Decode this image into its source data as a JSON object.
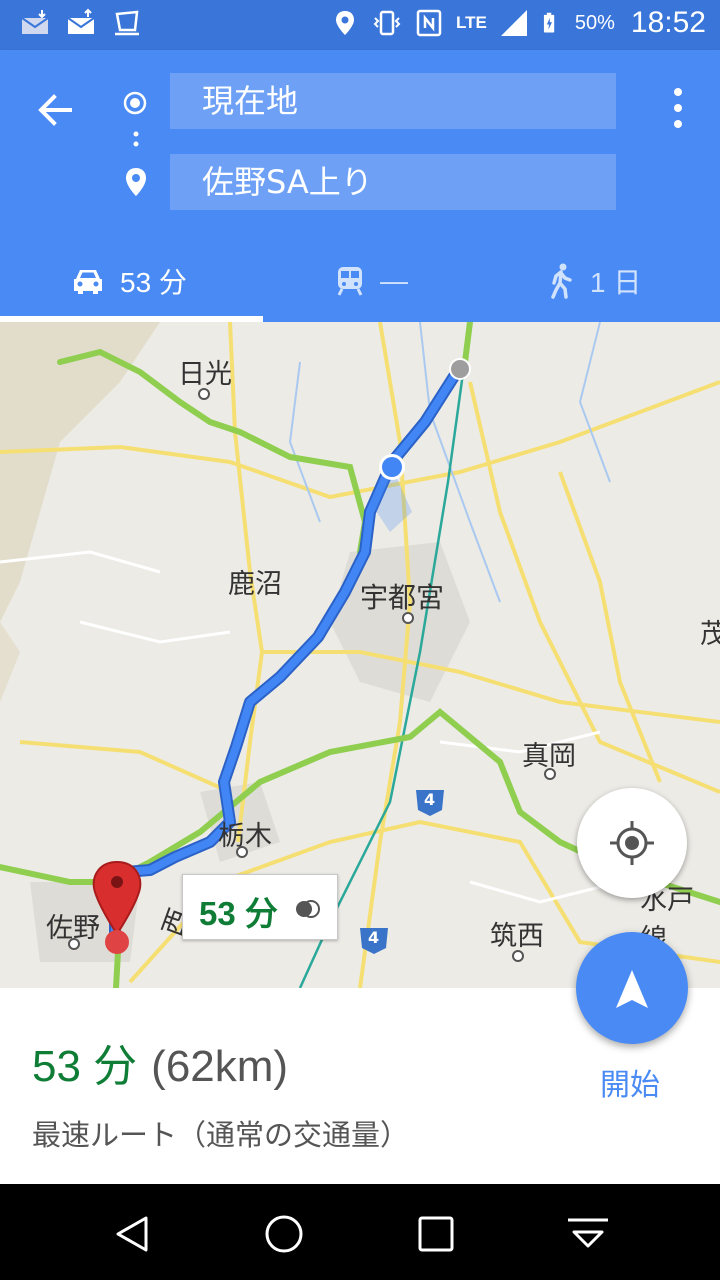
{
  "status_bar": {
    "icons": [
      "mail-download-icon",
      "mail-upload-icon",
      "cup-icon",
      "location-icon",
      "vibrate-icon",
      "nfc-icon",
      "signal-icon",
      "battery-icon"
    ],
    "network": "LTE",
    "battery": "50%",
    "time": "18:52"
  },
  "header": {
    "origin": "現在地",
    "destination": "佐野SA上り",
    "tabs": [
      {
        "icon": "car-icon",
        "label": "53 分",
        "selected": true
      },
      {
        "icon": "train-icon",
        "label": "—",
        "selected": false
      },
      {
        "icon": "walk-icon",
        "label": "1 日",
        "selected": false
      }
    ]
  },
  "map": {
    "places": [
      "日光",
      "鹿沼",
      "宇都宮",
      "真岡",
      "栃木",
      "佐野",
      "筑西",
      "茂",
      "水戸線",
      "西"
    ],
    "road_shields": [
      "4",
      "4"
    ],
    "route_badge": "53 分",
    "colors": {
      "route": "#4286f5",
      "highway": "#8fce4f",
      "road": "#f7e27a",
      "rail": "#2aa89a"
    }
  },
  "bottom_sheet": {
    "duration": "53 分",
    "distance": "(62km)",
    "description": "最速ルート（通常の交通量）",
    "start_label": "開始"
  },
  "nav_bar": {
    "icons": [
      "back-triangle-icon",
      "home-circle-icon",
      "recents-square-icon",
      "hide-keyboard-icon"
    ]
  }
}
